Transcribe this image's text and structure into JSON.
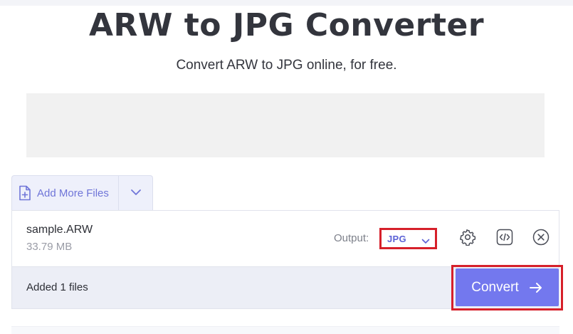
{
  "header": {
    "title": "ARW to JPG Converter",
    "subtitle": "Convert ARW to JPG online, for free."
  },
  "uploader": {
    "add_more_label": "Add More Files",
    "add_icon": "file-plus-icon",
    "dropdown_icon": "chevron-down-icon"
  },
  "file": {
    "name": "sample.ARW",
    "size": "33.79 MB",
    "output_label": "Output:",
    "output_value": "JPG",
    "actions": [
      "settings-icon",
      "code-icon",
      "close-circle-icon"
    ]
  },
  "footer_bar": {
    "added_text": "Added 1 files",
    "convert_label": "Convert",
    "convert_icon": "arrow-right-icon"
  },
  "colors": {
    "accent": "#7378ee",
    "accent_text": "#6f75d8",
    "highlight": "#d6202a",
    "ad_placeholder": "#f1f1f1"
  }
}
